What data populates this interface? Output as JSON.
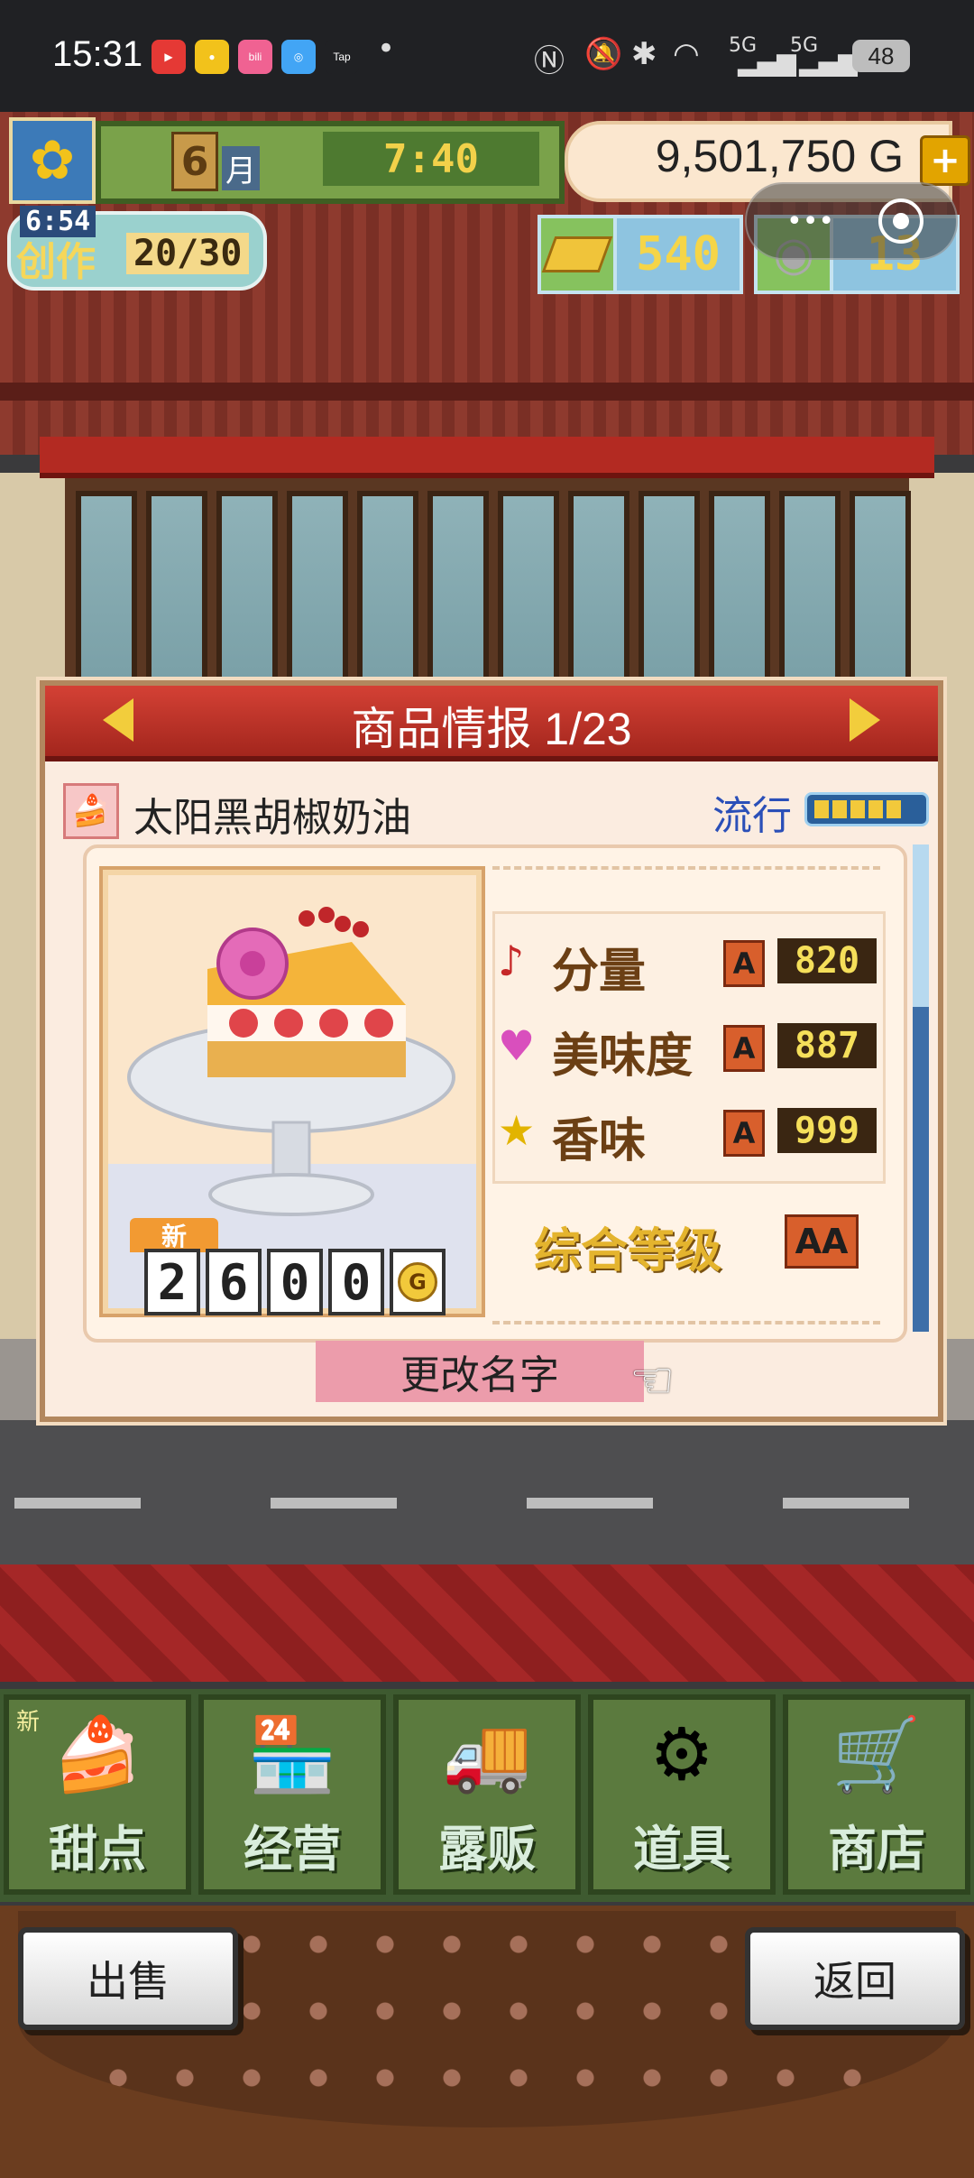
{
  "status_bar": {
    "time": "15:31",
    "apps": [
      {
        "name": "youtube",
        "label": "▶",
        "color": "#e53935"
      },
      {
        "name": "app2",
        "label": "●",
        "color": "#f2c21b"
      },
      {
        "name": "bilibili",
        "label": "bili",
        "color": "#f06292"
      },
      {
        "name": "chat",
        "label": "◎",
        "color": "#42a5f5"
      },
      {
        "name": "taptap",
        "label": "Tap",
        "color": "#202124"
      }
    ],
    "network": "5G",
    "battery": "48"
  },
  "hud": {
    "month": "6",
    "month_unit": "月",
    "clock": "7:40",
    "money": "9,501,750",
    "money_unit": "G",
    "create_timer": "6:54",
    "create_label": "创作",
    "create_count": "20/30",
    "gold_count": "540",
    "coin_count": "13"
  },
  "dialog": {
    "title": "商品情报 1/23",
    "product_name": "太阳黑胡椒奶油",
    "trend_label": "流行",
    "trend_level": 5,
    "new_tag": "新",
    "price_digits": [
      "2",
      "6",
      "0",
      "0"
    ],
    "price_unit": "G",
    "stats": [
      {
        "label": "分量",
        "icon": "music-note-icon",
        "glyph": "♪",
        "color": "#c62828",
        "grade": "A",
        "value": "820"
      },
      {
        "label": "美味度",
        "icon": "heart-icon",
        "glyph": "♥",
        "color": "#d94fbd",
        "grade": "A",
        "value": "887"
      },
      {
        "label": "香味",
        "icon": "star-icon",
        "glyph": "★",
        "color": "#e2b400",
        "grade": "A",
        "value": "999"
      }
    ],
    "overall_label": "综合等级",
    "overall_grade": "AA",
    "rename_button": "更改名字"
  },
  "nav": [
    {
      "key": "dessert",
      "label": "甜点",
      "art": "🍰",
      "new": "新"
    },
    {
      "key": "manage",
      "label": "经营",
      "art": "🏪",
      "new": ""
    },
    {
      "key": "stall",
      "label": "露贩",
      "art": "🚚",
      "new": ""
    },
    {
      "key": "items",
      "label": "道具",
      "art": "⚙",
      "new": ""
    },
    {
      "key": "shop",
      "label": "商店",
      "art": "🛒",
      "new": ""
    }
  ],
  "footer": {
    "sell": "出售",
    "back": "返回"
  }
}
